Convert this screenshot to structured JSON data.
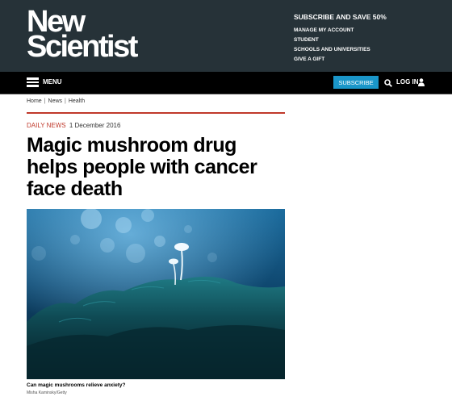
{
  "brand": {
    "line1": "New",
    "line2": "Scientist"
  },
  "top_links": {
    "primary": "SUBSCRIBE AND SAVE 50%",
    "items": [
      "MANAGE MY ACCOUNT",
      "STUDENT",
      "SCHOOLS AND UNIVERSITIES",
      "GIVE A GIFT"
    ]
  },
  "nav": {
    "menu_label": "MENU",
    "subscribe_label": "SUBSCRIBE",
    "login_label": "LOG IN"
  },
  "breadcrumb": [
    "Home",
    "News",
    "Health"
  ],
  "article": {
    "section": "Daily news",
    "date": "1 December 2016",
    "headline": "Magic mushroom drug helps people with cancer face death",
    "caption": "Can magic mushrooms relieve anxiety?",
    "credit": "Misha Kaminsky/Getty"
  },
  "icons": {
    "menu": "hamburger-icon",
    "search": "search-icon",
    "user": "user-icon"
  },
  "colors": {
    "masthead": "#263238",
    "navbar": "#000000",
    "accent": "#c0392b",
    "subscribe": "#1a96c9"
  }
}
